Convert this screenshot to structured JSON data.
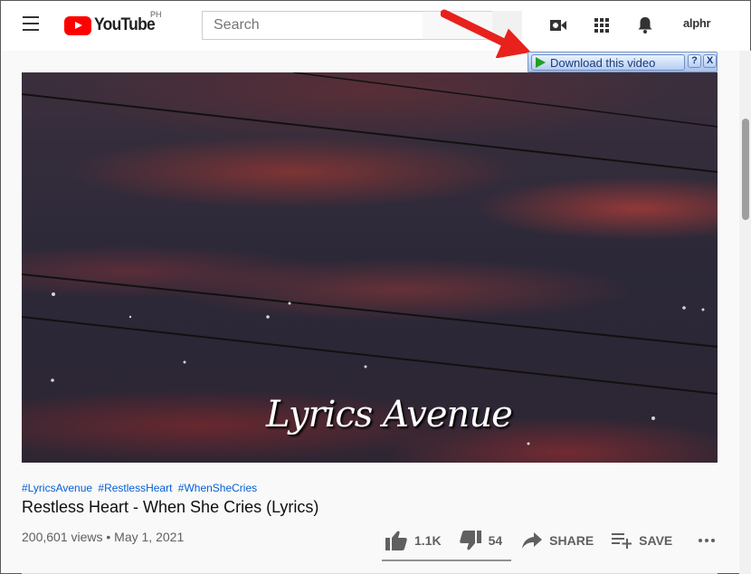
{
  "header": {
    "logo_text": "YouTube",
    "country_code": "PH",
    "search_placeholder": "Search",
    "account_label": "alphr"
  },
  "download_widget": {
    "label": "Download this video",
    "help": "?",
    "close": "X"
  },
  "video": {
    "overlay_text": "Lyrics Avenue"
  },
  "details": {
    "hashtags": [
      "#LyricsAvenue",
      "#RestlessHeart",
      "#WhenSheCries"
    ],
    "title": "Restless Heart - When She Cries (Lyrics)",
    "views_date": "200,601 views • May 1, 2021",
    "like_count": "1.1K",
    "dislike_count": "54",
    "share_label": "SHARE",
    "save_label": "SAVE",
    "like_ratio": 0.95
  },
  "colors": {
    "brand_red": "#ff0000",
    "link_blue": "#065fd4",
    "arrow_red": "#e8211c"
  }
}
